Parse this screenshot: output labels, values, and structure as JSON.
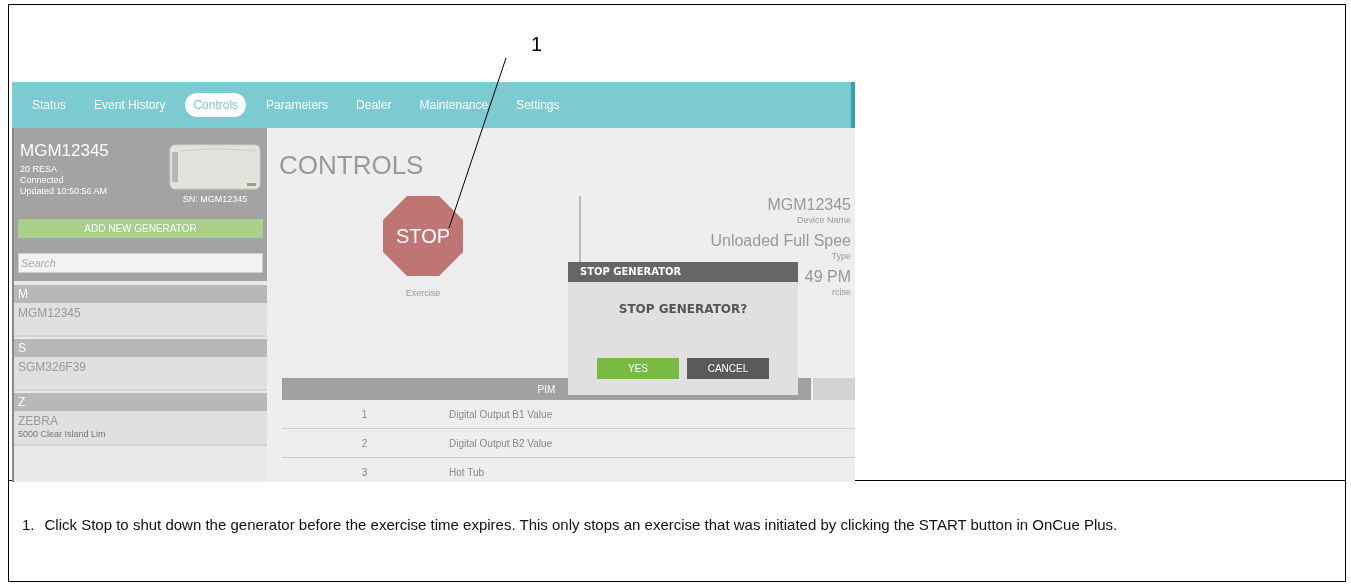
{
  "callout": {
    "label": "1"
  },
  "nav": {
    "tabs": [
      {
        "label": "Status",
        "selected": false
      },
      {
        "label": "Event History",
        "selected": false
      },
      {
        "label": "Controls",
        "selected": true
      },
      {
        "label": "Parameters",
        "selected": false
      },
      {
        "label": "Dealer",
        "selected": false
      },
      {
        "label": "Maintenance",
        "selected": false
      },
      {
        "label": "Settings",
        "selected": false
      }
    ]
  },
  "device": {
    "name": "MGM12345",
    "model": "20 RESA",
    "status": "Connected",
    "updated": "Updated 10:50:56 AM",
    "serial": "SN: MGM12345"
  },
  "sidebar": {
    "add_button": "ADD NEW GENERATOR",
    "search": {
      "placeholder": "Search"
    },
    "groups": [
      {
        "letter": "M",
        "items": [
          {
            "name": "MGM12345"
          }
        ]
      },
      {
        "letter": "S",
        "items": [
          {
            "name": "SGM326F39"
          }
        ]
      },
      {
        "letter": "Z",
        "items": [
          {
            "name": "ZEBRA",
            "address": "5000 Clear Island Lim"
          }
        ]
      }
    ]
  },
  "controls": {
    "title": "CONTROLS",
    "stop_button": "STOP",
    "stop_caption": "Exercise",
    "info": [
      {
        "value": "MGM12345",
        "label": "Device Name"
      },
      {
        "value": "Unloaded Full Spee",
        "label": "Type"
      },
      {
        "value": "49 PM",
        "label": "rcise"
      }
    ]
  },
  "table": {
    "columns": [
      "PIM"
    ],
    "rows": [
      {
        "number": "1",
        "name": "Digital Output B1 Value"
      },
      {
        "number": "2",
        "name": "Digital Output B2 Value"
      },
      {
        "number": "3",
        "name": "Hot Tub"
      }
    ]
  },
  "dialog": {
    "title": "STOP GENERATOR",
    "message": "STOP GENERATOR?",
    "buttons": [
      {
        "label": "YES",
        "kind": "confirm"
      },
      {
        "label": "CANCEL",
        "kind": "cancel"
      }
    ]
  },
  "notes": [
    {
      "number": "1.",
      "text": "Click Stop to shut down the generator before the exercise time expires.  This only stops an exercise that was initiated by clicking the START button in OnCue Plus."
    }
  ]
}
